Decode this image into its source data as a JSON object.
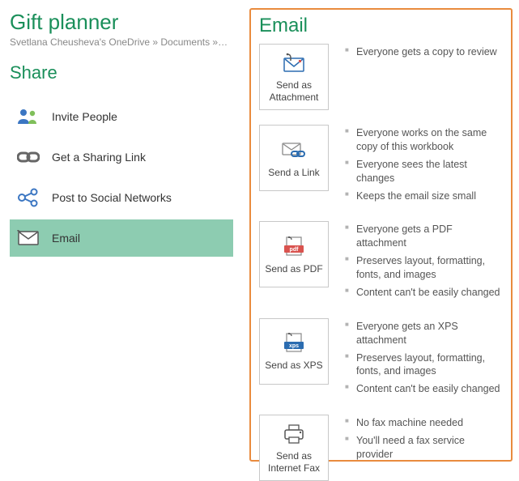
{
  "title": "Gift planner",
  "breadcrumb": "Svetlana Cheusheva's OneDrive » Documents » G…",
  "share_heading": "Share",
  "share_items": [
    {
      "label": "Invite People"
    },
    {
      "label": "Get a Sharing Link"
    },
    {
      "label": "Post to Social Networks"
    },
    {
      "label": "Email"
    }
  ],
  "email_heading": "Email",
  "email_options": [
    {
      "label": "Send as Attachment",
      "bullets": [
        "Everyone gets a copy to review"
      ]
    },
    {
      "label": "Send a Link",
      "bullets": [
        "Everyone works on the same copy of this workbook",
        "Everyone sees the latest changes",
        "Keeps the email size small"
      ]
    },
    {
      "label": "Send as PDF",
      "bullets": [
        "Everyone gets a PDF attachment",
        "Preserves layout, formatting, fonts, and images",
        "Content can't be easily changed"
      ]
    },
    {
      "label": "Send as XPS",
      "bullets": [
        "Everyone gets an XPS attachment",
        "Preserves layout, formatting, fonts, and images",
        "Content can't be easily changed"
      ]
    },
    {
      "label": "Send as Internet Fax",
      "bullets": [
        "No fax machine needed",
        "You'll need a fax service provider"
      ]
    }
  ]
}
